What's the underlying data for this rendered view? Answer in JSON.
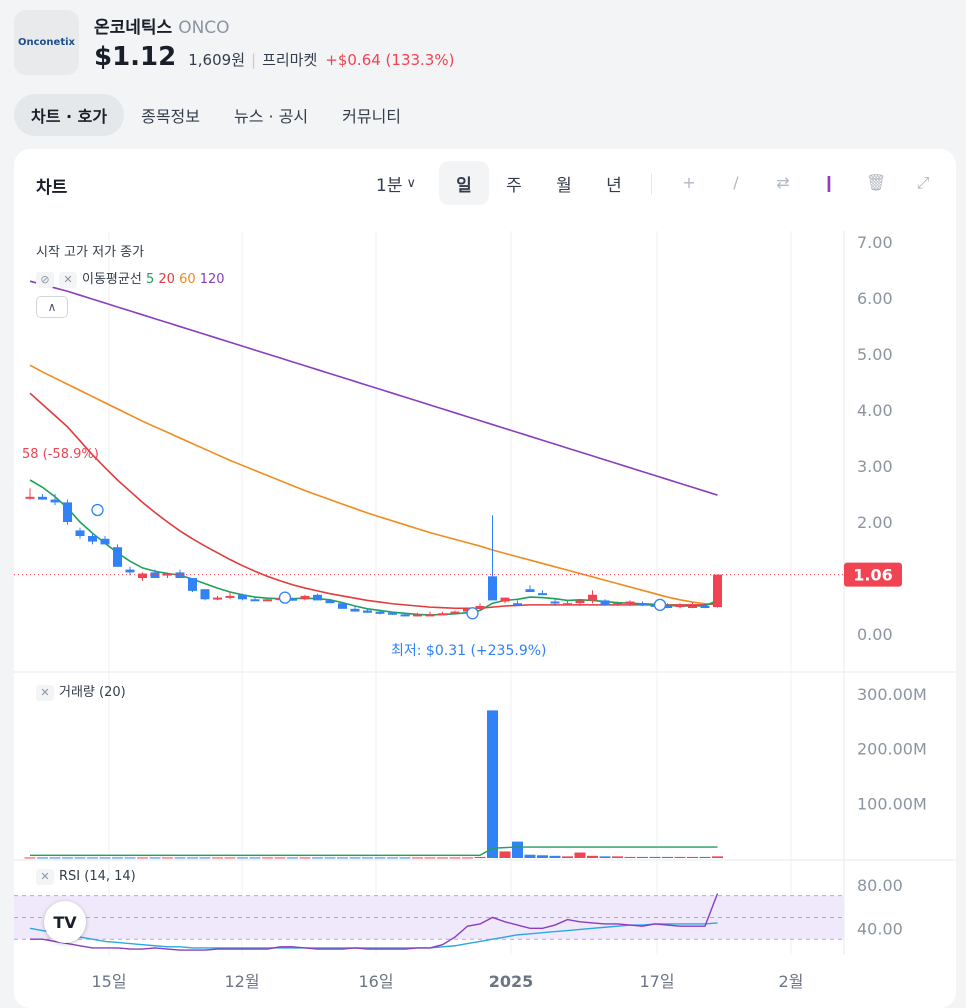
{
  "stock": {
    "logo_text": "Onconetix",
    "name": "온코네틱스",
    "ticker": "ONCO",
    "price": "$1.12",
    "price_krw": "1,609원",
    "session": "프리마켓",
    "change": "+$0.64 (133.3%)"
  },
  "tabs": [
    "차트 · 호가",
    "종목정보",
    "뉴스 · 공시",
    "커뮤니티"
  ],
  "chart_header": {
    "title": "차트",
    "interval": "1분",
    "periods": [
      "일",
      "주",
      "월",
      "년"
    ],
    "tools": [
      "plus-icon",
      "pen-icon",
      "swap-icon",
      "candle-icon",
      "trash-icon",
      "expand-icon"
    ]
  },
  "legend": {
    "ohlc": "시작 고가 저가 종가",
    "ma_label": "이동평균선",
    "ma_periods": [
      "5",
      "20",
      "60",
      "120"
    ],
    "ma_colors": [
      "#1fa15a",
      "#e03c3c",
      "#f08b1e",
      "#8a3dbf"
    ],
    "volume_label": "거래량 (20)",
    "rsi_label": "RSI (14, 14)"
  },
  "annotations": {
    "high_marker": "58 (-58.9%)",
    "low_marker": "최저: $0.31 (+235.9%)",
    "current_price_tag": "1.06"
  },
  "colors": {
    "up": "#f04452",
    "down": "#3182f6",
    "accent_red": "#f04452",
    "rsi_band": "#efe9fb"
  },
  "chart_data": [
    {
      "type": "candlestick",
      "title": "",
      "ylim": [
        0,
        7
      ],
      "y_ticks": [
        "7.00",
        "6.00",
        "5.00",
        "4.00",
        "3.00",
        "2.00",
        "1.00",
        "0.00"
      ],
      "x_ticks": [
        "15일",
        "12월",
        "16일",
        "2025",
        "17일",
        "2월"
      ],
      "ohlc": [
        [
          2.45,
          2.6,
          2.4,
          2.45
        ],
        [
          2.45,
          2.5,
          2.4,
          2.4
        ],
        [
          2.4,
          2.5,
          2.3,
          2.35
        ],
        [
          2.35,
          2.4,
          1.95,
          2.0
        ],
        [
          1.85,
          1.9,
          1.7,
          1.75
        ],
        [
          1.75,
          1.8,
          1.6,
          1.65
        ],
        [
          1.7,
          1.75,
          1.6,
          1.6
        ],
        [
          1.55,
          1.6,
          1.2,
          1.2
        ],
        [
          1.15,
          1.2,
          1.05,
          1.1
        ],
        [
          1.0,
          1.1,
          0.95,
          1.08
        ],
        [
          1.1,
          1.15,
          1.0,
          1.0
        ],
        [
          1.05,
          1.1,
          1.0,
          1.08
        ],
        [
          1.1,
          1.15,
          1.0,
          1.0
        ],
        [
          1.0,
          1.0,
          0.75,
          0.77
        ],
        [
          0.8,
          0.8,
          0.6,
          0.62
        ],
        [
          0.62,
          0.68,
          0.6,
          0.65
        ],
        [
          0.65,
          0.75,
          0.62,
          0.68
        ],
        [
          0.7,
          0.72,
          0.6,
          0.62
        ],
        [
          0.62,
          0.65,
          0.6,
          0.6
        ],
        [
          0.6,
          0.65,
          0.58,
          0.62
        ],
        [
          0.63,
          0.66,
          0.6,
          0.64
        ],
        [
          0.63,
          0.65,
          0.6,
          0.62
        ],
        [
          0.62,
          0.7,
          0.6,
          0.68
        ],
        [
          0.7,
          0.72,
          0.62,
          0.6
        ],
        [
          0.6,
          0.62,
          0.55,
          0.55
        ],
        [
          0.55,
          0.57,
          0.48,
          0.45
        ],
        [
          0.45,
          0.5,
          0.4,
          0.4
        ],
        [
          0.42,
          0.45,
          0.38,
          0.38
        ],
        [
          0.4,
          0.42,
          0.35,
          0.36
        ],
        [
          0.38,
          0.4,
          0.34,
          0.36
        ],
        [
          0.35,
          0.38,
          0.32,
          0.33
        ],
        [
          0.33,
          0.38,
          0.31,
          0.35
        ],
        [
          0.35,
          0.4,
          0.33,
          0.35
        ],
        [
          0.36,
          0.4,
          0.34,
          0.37
        ],
        [
          0.37,
          0.42,
          0.35,
          0.4
        ],
        [
          0.4,
          0.45,
          0.38,
          0.45
        ],
        [
          0.45,
          0.55,
          0.42,
          0.5
        ],
        [
          1.03,
          2.12,
          0.7,
          0.6
        ],
        [
          0.58,
          0.65,
          0.55,
          0.65
        ],
        [
          0.55,
          0.6,
          0.5,
          0.52
        ],
        [
          0.8,
          0.87,
          0.75,
          0.75
        ],
        [
          0.73,
          0.78,
          0.7,
          0.7
        ],
        [
          0.58,
          0.62,
          0.5,
          0.55
        ],
        [
          0.55,
          0.6,
          0.52,
          0.55
        ],
        [
          0.55,
          0.6,
          0.5,
          0.6
        ],
        [
          0.6,
          0.78,
          0.55,
          0.7
        ],
        [
          0.6,
          0.62,
          0.5,
          0.52
        ],
        [
          0.52,
          0.58,
          0.5,
          0.55
        ],
        [
          0.55,
          0.6,
          0.5,
          0.58
        ],
        [
          0.55,
          0.58,
          0.5,
          0.52
        ],
        [
          0.52,
          0.56,
          0.48,
          0.5
        ],
        [
          0.5,
          0.55,
          0.46,
          0.48
        ],
        [
          0.48,
          0.55,
          0.46,
          0.52
        ],
        [
          0.5,
          0.56,
          0.46,
          0.5
        ],
        [
          0.5,
          0.55,
          0.46,
          0.48
        ],
        [
          0.48,
          1.06,
          0.47,
          1.06
        ]
      ],
      "ma5": [
        2.75,
        2.62,
        2.45,
        2.25,
        2.0,
        1.8,
        1.62,
        1.45,
        1.3,
        1.18,
        1.12,
        1.08,
        1.05,
        0.98,
        0.9,
        0.82,
        0.75,
        0.7,
        0.66,
        0.64,
        0.63,
        0.63,
        0.64,
        0.63,
        0.61,
        0.56,
        0.5,
        0.45,
        0.42,
        0.39,
        0.37,
        0.35,
        0.34,
        0.35,
        0.36,
        0.38,
        0.42,
        0.55,
        0.6,
        0.62,
        0.66,
        0.65,
        0.63,
        0.6,
        0.61,
        0.6,
        0.58,
        0.56,
        0.55,
        0.54,
        0.53,
        0.51,
        0.5,
        0.5,
        0.5,
        0.6
      ],
      "ma20": [
        4.3,
        4.1,
        3.9,
        3.7,
        3.45,
        3.2,
        2.97,
        2.75,
        2.55,
        2.35,
        2.17,
        2.0,
        1.84,
        1.7,
        1.57,
        1.45,
        1.33,
        1.22,
        1.12,
        1.03,
        0.95,
        0.88,
        0.82,
        0.77,
        0.72,
        0.68,
        0.64,
        0.6,
        0.57,
        0.54,
        0.52,
        0.5,
        0.48,
        0.47,
        0.46,
        0.46,
        0.46,
        0.48,
        0.5,
        0.51,
        0.52,
        0.52,
        0.52,
        0.52,
        0.52,
        0.52,
        0.52,
        0.52,
        0.52,
        0.52,
        0.52,
        0.52,
        0.52,
        0.52,
        0.52,
        0.55
      ],
      "ma60": [
        4.8,
        4.68,
        4.57,
        4.46,
        4.35,
        4.24,
        4.13,
        4.02,
        3.91,
        3.8,
        3.7,
        3.6,
        3.5,
        3.4,
        3.3,
        3.2,
        3.1,
        3.01,
        2.92,
        2.83,
        2.74,
        2.65,
        2.56,
        2.48,
        2.4,
        2.32,
        2.24,
        2.16,
        2.09,
        2.02,
        1.95,
        1.88,
        1.81,
        1.75,
        1.69,
        1.63,
        1.57,
        1.5,
        1.44,
        1.38,
        1.32,
        1.26,
        1.2,
        1.14,
        1.08,
        1.02,
        0.96,
        0.9,
        0.84,
        0.78,
        0.72,
        0.66,
        0.61,
        0.57,
        0.54,
        0.53
      ],
      "ma120": [
        6.3,
        6.24,
        6.18,
        6.12,
        6.05,
        5.98,
        5.91,
        5.84,
        5.77,
        5.7,
        5.63,
        5.56,
        5.49,
        5.42,
        5.35,
        5.28,
        5.21,
        5.14,
        5.07,
        5.0,
        4.93,
        4.86,
        4.79,
        4.72,
        4.65,
        4.58,
        4.51,
        4.44,
        4.37,
        4.3,
        4.23,
        4.16,
        4.09,
        4.02,
        3.95,
        3.88,
        3.81,
        3.74,
        3.67,
        3.6,
        3.53,
        3.46,
        3.39,
        3.32,
        3.25,
        3.18,
        3.11,
        3.04,
        2.97,
        2.9,
        2.83,
        2.76,
        2.69,
        2.62,
        2.55,
        2.48
      ]
    },
    {
      "type": "bar",
      "title": "",
      "ylim": [
        0,
        300
      ],
      "y_ticks": [
        "300.00M",
        "200.00M",
        "100.00M"
      ],
      "values": [
        1,
        1,
        1,
        1,
        1,
        1,
        1,
        1,
        1,
        1,
        1,
        1,
        1,
        1,
        1,
        1,
        1,
        1,
        1,
        1,
        1,
        1,
        1,
        1,
        1,
        1,
        1,
        1,
        1,
        1,
        1,
        1,
        1,
        1,
        1,
        1,
        2,
        270,
        12,
        30,
        6,
        5,
        4,
        3,
        10,
        4,
        3,
        3,
        2,
        2,
        2,
        2,
        2,
        2,
        2,
        3
      ],
      "ma20": [
        5,
        5,
        5,
        5,
        5,
        5,
        5,
        5,
        5,
        5,
        5,
        5,
        5,
        5,
        5,
        5,
        5,
        5,
        5,
        5,
        5,
        5,
        5,
        5,
        5,
        5,
        5,
        5,
        5,
        5,
        5,
        5,
        5,
        5,
        5,
        5,
        5,
        18,
        19,
        20,
        20,
        20,
        20,
        20,
        20,
        20,
        20,
        20,
        20,
        20,
        20,
        20,
        20,
        20,
        20,
        20
      ]
    },
    {
      "type": "line",
      "title": "",
      "ylim": [
        10,
        100
      ],
      "y_ticks": [
        "80.00",
        "40.00"
      ],
      "bands": [
        70,
        50,
        30
      ],
      "rsi": [
        30,
        30,
        28,
        26,
        24,
        22,
        22,
        22,
        21,
        21,
        22,
        21,
        20,
        20,
        20,
        21,
        21,
        21,
        21,
        21,
        23,
        23,
        22,
        21,
        21,
        21,
        22,
        21,
        21,
        21,
        21,
        22,
        22,
        25,
        32,
        42,
        44,
        50,
        46,
        43,
        40,
        40,
        43,
        48,
        46,
        45,
        44,
        44,
        43,
        42,
        44,
        43,
        42,
        42,
        42,
        72
      ],
      "signal": [
        40,
        38,
        36,
        34,
        32,
        30,
        28,
        27,
        26,
        25,
        24,
        23,
        23,
        22,
        22,
        22,
        22,
        22,
        22,
        22,
        22,
        22,
        22,
        22,
        22,
        22,
        22,
        22,
        22,
        22,
        22,
        22,
        22,
        23,
        24,
        26,
        28,
        30,
        32,
        34,
        35,
        36,
        37,
        38,
        39,
        40,
        41,
        42,
        43,
        43,
        44,
        44,
        44,
        44,
        44,
        45
      ]
    }
  ]
}
